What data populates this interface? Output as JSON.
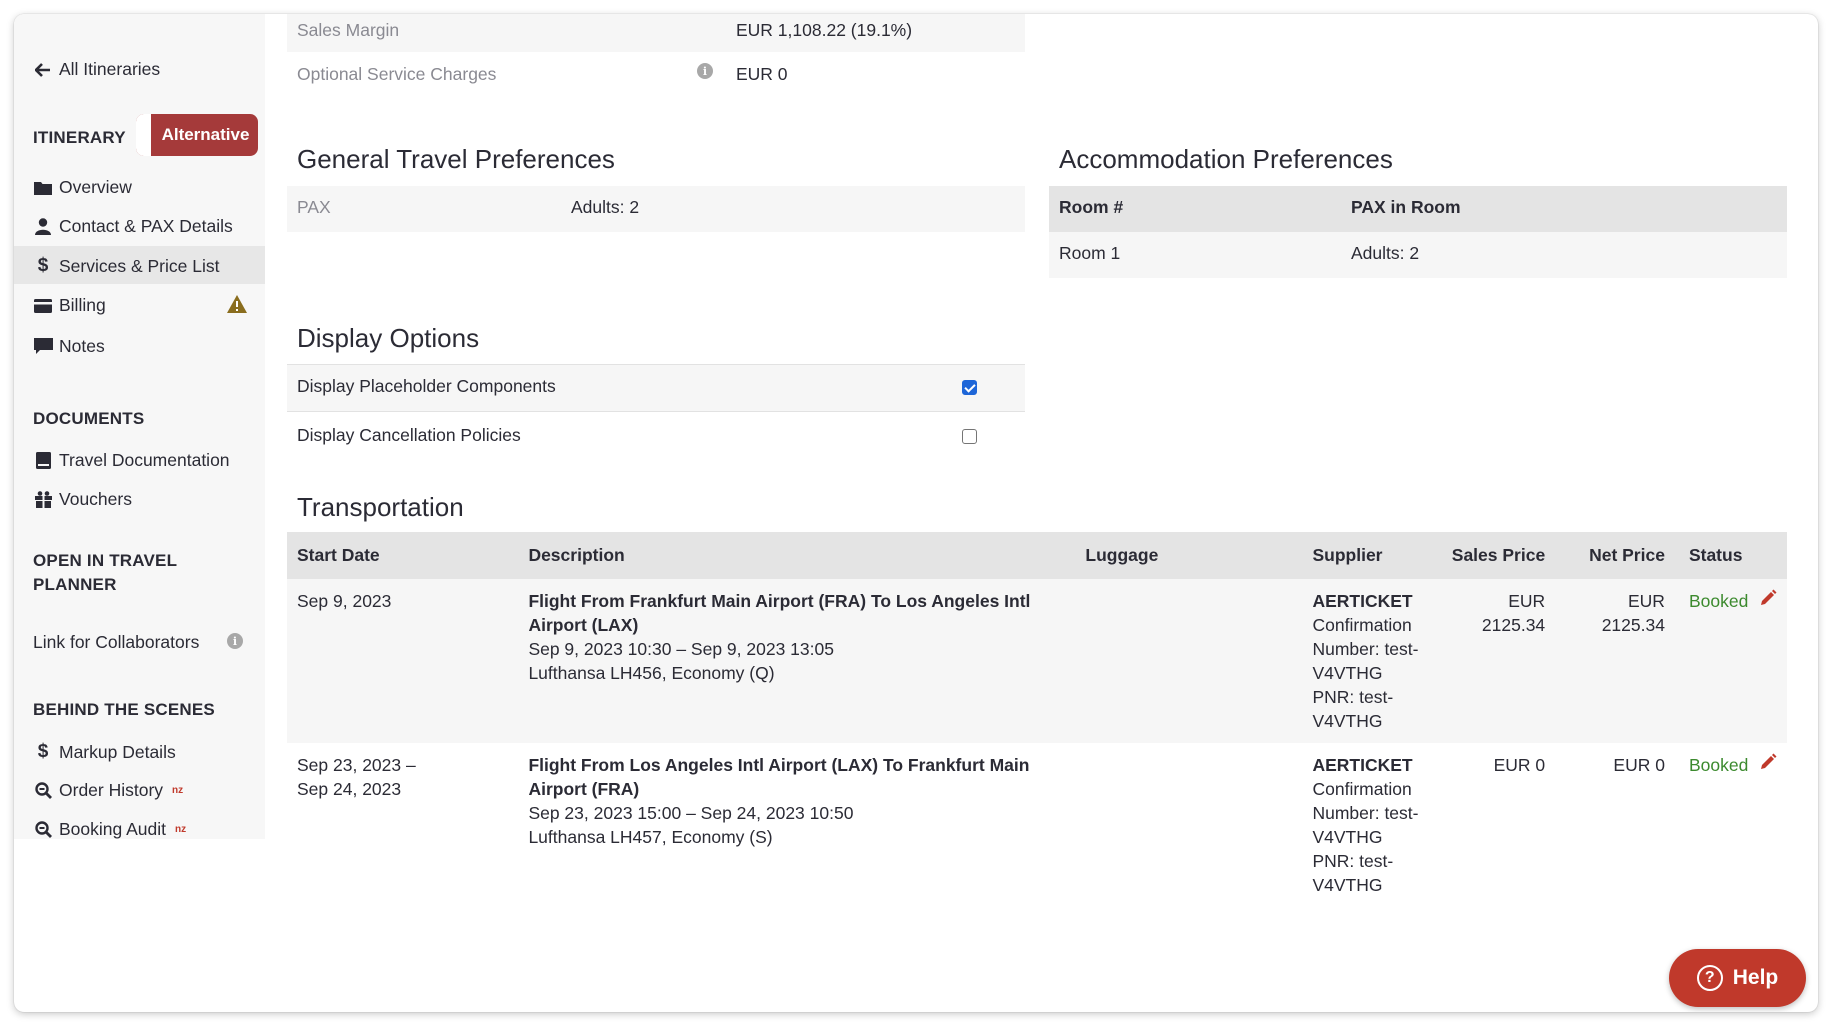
{
  "sidebar": {
    "back_link": "All Itineraries",
    "itinerary_heading": "ITINERARY",
    "itinerary_toggle": "Alternative",
    "items": [
      {
        "label": "Overview",
        "icon": "folder-icon"
      },
      {
        "label": "Contact & PAX Details",
        "icon": "user-icon"
      },
      {
        "label": "Services & Price List",
        "icon": "dollar-icon"
      },
      {
        "label": "Billing",
        "icon": "credit-card-icon"
      },
      {
        "label": "Notes",
        "icon": "comment-icon"
      }
    ],
    "documents_heading": "DOCUMENTS",
    "documents_items": [
      {
        "label": "Travel Documentation",
        "icon": "book-icon"
      },
      {
        "label": "Vouchers",
        "icon": "gift-icon"
      }
    ],
    "planner_heading": "OPEN IN TRAVEL PLANNER",
    "planner_link": "Link for Collaborators",
    "behind_heading": "BEHIND THE SCENES",
    "behind_items": [
      {
        "label": "Markup Details",
        "icon": "dollar-icon",
        "badge": ""
      },
      {
        "label": "Order History",
        "icon": "search-icon",
        "badge": "nz"
      },
      {
        "label": "Booking Audit",
        "icon": "search-icon",
        "badge": "nz"
      }
    ]
  },
  "pricing": {
    "sales_margin_label": "Sales Margin",
    "sales_margin_value": "EUR 1,108.22 (19.1%)",
    "optional_label": "Optional Service Charges",
    "optional_value": "EUR 0"
  },
  "general_prefs": {
    "title": "General Travel Preferences",
    "pax_label": "PAX",
    "pax_value": "Adults: 2"
  },
  "accommodation": {
    "title": "Accommodation Preferences",
    "col_room": "Room #",
    "col_pax": "PAX in Room",
    "rows": [
      {
        "room": "Room 1",
        "pax": "Adults: 2"
      }
    ]
  },
  "display_options": {
    "title": "Display Options",
    "options": [
      {
        "label": "Display Placeholder Components",
        "checked": true
      },
      {
        "label": "Display Cancellation Policies",
        "checked": false
      }
    ]
  },
  "transportation": {
    "title": "Transportation",
    "columns": [
      "Start Date",
      "Description",
      "Luggage",
      "Supplier",
      "Sales Price",
      "Net Price",
      "Status"
    ],
    "rows": [
      {
        "date": "Sep 9, 2023",
        "title": "Flight From Frankfurt Main Airport (FRA) To Los Angeles Intl Airport (LAX)",
        "times": "Sep 9, 2023 10:30 – Sep 9, 2023 13:05",
        "flight": "Lufthansa LH456, Economy (Q)",
        "luggage": "",
        "supplier": "AERTICKET",
        "supplier_details": "Confirmation Number: test-V4VTHG PNR: test-V4VTHG",
        "sales_price": "EUR 2125.34",
        "net_price": "EUR 2125.34",
        "status": "Booked"
      },
      {
        "date": "Sep 23, 2023 – Sep 24, 2023",
        "title": "Flight From Los Angeles Intl Airport (LAX) To Frankfurt Main Airport (FRA)",
        "times": "Sep 23, 2023 15:00 – Sep 24, 2023 10:50",
        "flight": "Lufthansa LH457, Economy (S)",
        "luggage": "",
        "supplier": "AERTICKET",
        "supplier_details": "Confirmation Number: test-V4VTHG PNR: test-V4VTHG",
        "sales_price": "EUR 0",
        "net_price": "EUR 0",
        "status": "Booked"
      }
    ]
  },
  "help_button": "Help",
  "colors": {
    "accent_red": "#a53a3a",
    "help_red": "#c0392b",
    "booked_green": "#3c8a2e",
    "checkbox_blue": "#1e66d8"
  }
}
